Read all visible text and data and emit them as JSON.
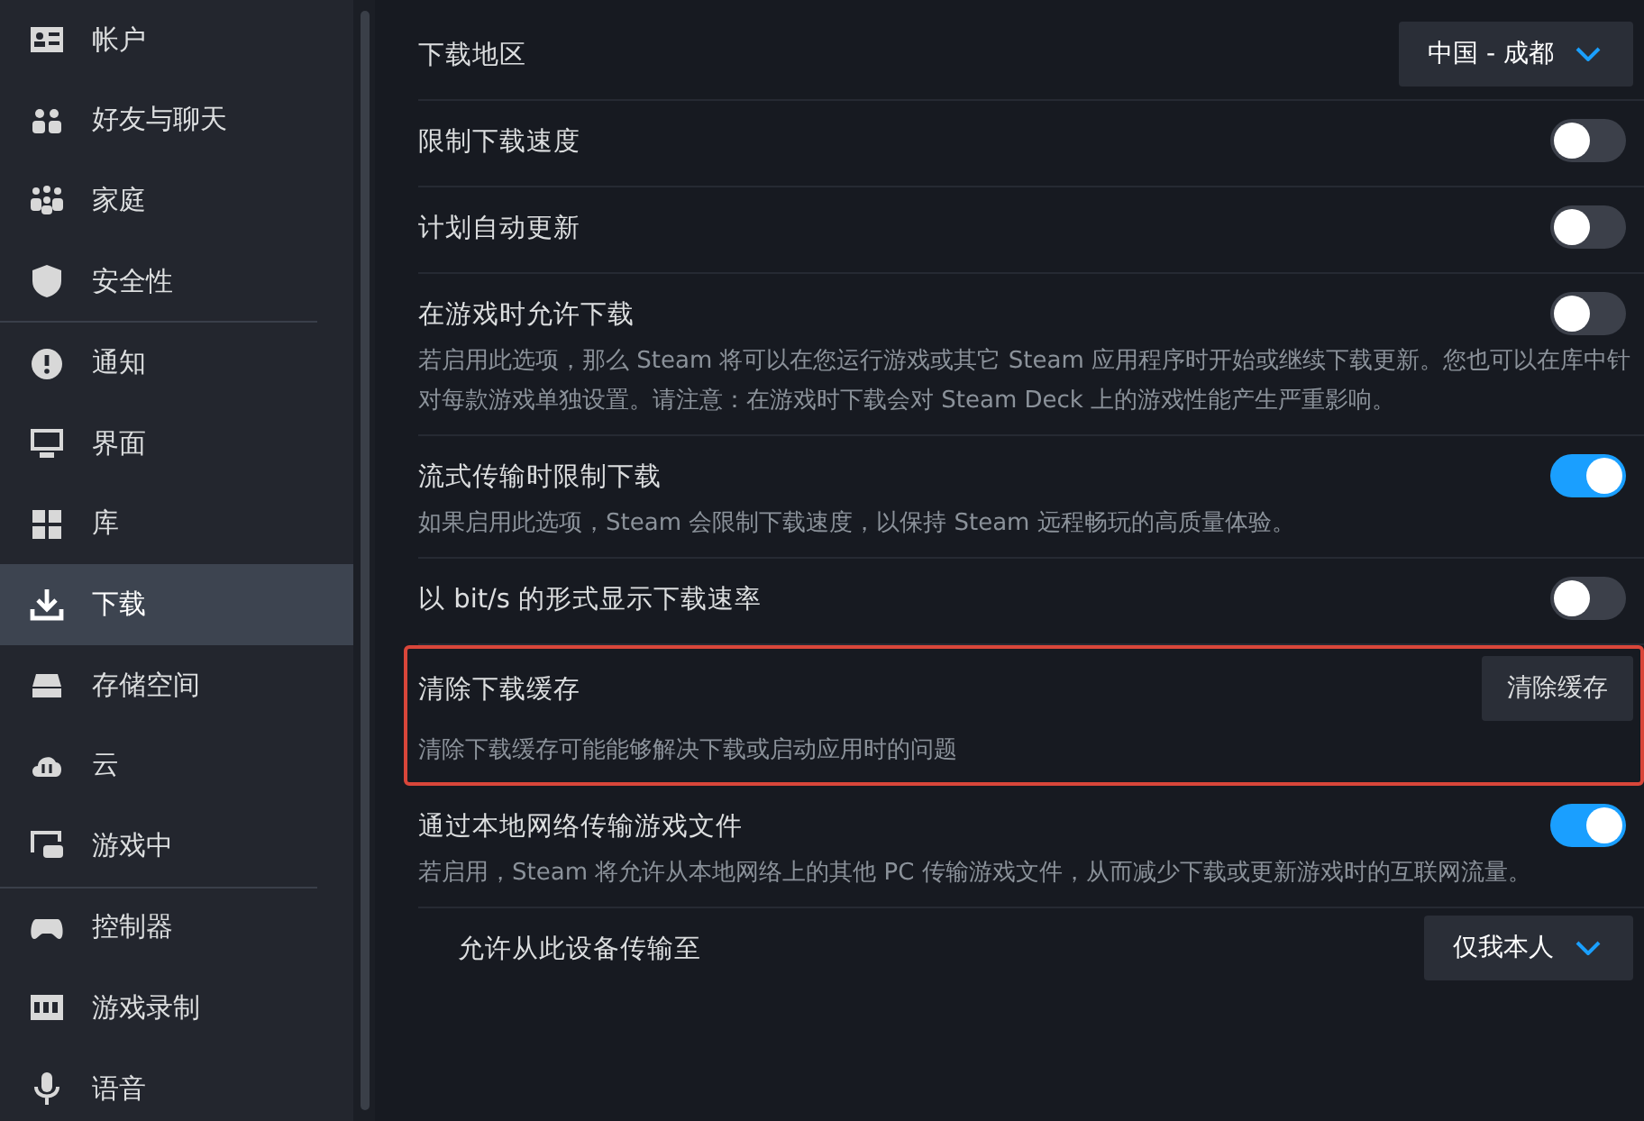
{
  "sidebar": {
    "groups": [
      {
        "items": [
          {
            "label": "帐户",
            "selected": false
          },
          {
            "label": "好友与聊天",
            "selected": false
          },
          {
            "label": "家庭",
            "selected": false
          },
          {
            "label": "安全性",
            "selected": false
          }
        ]
      },
      {
        "items": [
          {
            "label": "通知",
            "selected": false
          },
          {
            "label": "界面",
            "selected": false
          },
          {
            "label": "库",
            "selected": false
          },
          {
            "label": "下载",
            "selected": true
          },
          {
            "label": "存储空间",
            "selected": false
          },
          {
            "label": "云",
            "selected": false
          },
          {
            "label": "游戏中",
            "selected": false
          }
        ]
      },
      {
        "items": [
          {
            "label": "控制器",
            "selected": false
          },
          {
            "label": "游戏录制",
            "selected": false
          },
          {
            "label": "语音",
            "selected": false
          }
        ]
      }
    ]
  },
  "settings": [
    {
      "kind": "dropdown",
      "title": "下载地区",
      "value": "中国 - 成都"
    },
    {
      "kind": "toggle",
      "title": "限制下载速度",
      "on": false
    },
    {
      "kind": "toggle",
      "title": "计划自动更新",
      "on": false
    },
    {
      "kind": "toggle",
      "title": "在游戏时允许下载",
      "on": false,
      "description": "若启用此选项，那么 Steam 将可以在您运行游戏或其它 Steam 应用程序时开始或继续下载更新。您也可以在库中针对每款游戏单独设置。请注意：在游戏时下载会对 Steam Deck 上的游戏性能产生严重影响。"
    },
    {
      "kind": "toggle",
      "title": "流式传输时限制下载",
      "on": true,
      "description": "如果启用此选项，Steam 会限制下载速度，以保持 Steam 远程畅玩的高质量体验。"
    },
    {
      "kind": "toggle",
      "title": "以 bit/s 的形式显示下载速率",
      "on": false
    },
    {
      "kind": "button",
      "title": "清除下载缓存",
      "button": "清除缓存",
      "highlighted": true,
      "description": "清除下载缓存可能能够解决下载或启动应用时的问题"
    },
    {
      "kind": "toggle",
      "title": "通过本地网络传输游戏文件",
      "on": true,
      "description": "若启用，Steam 将允许从本地网络上的其他 PC 传输游戏文件，从而减少下载或更新游戏时的互联网流量。",
      "children": [
        {
          "kind": "dropdown",
          "title": "允许从此设备传输至",
          "value": "仅我本人"
        }
      ]
    }
  ]
}
